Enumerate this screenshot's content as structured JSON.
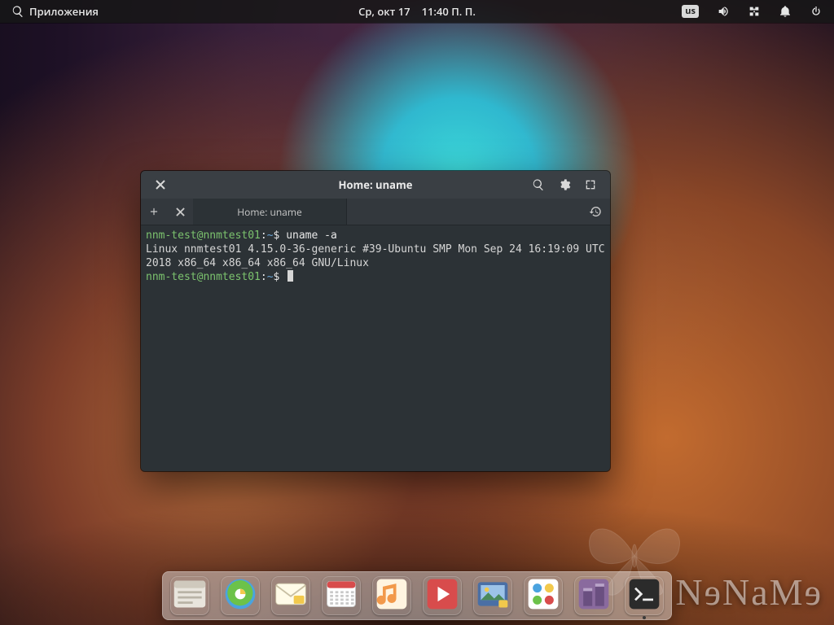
{
  "panel": {
    "apps_label": "Приложения",
    "date": "Ср, окт 17",
    "time": "11:40 П. П.",
    "keyboard_layout": "us"
  },
  "terminal": {
    "window_title": "Home: uname",
    "tab_title": "Home: uname",
    "lines": [
      {
        "user": "nnm-test@nnmtest01",
        "path": "~",
        "symbol": "$",
        "cmd": "uname -a"
      },
      {
        "text": "Linux nnmtest01 4.15.0-36-generic #39-Ubuntu SMP Mon Sep 24 16:19:09 UTC 2018 x86_64 x86_64 x86_64 GNU/Linux"
      },
      {
        "user": "nnm-test@nnmtest01",
        "path": "~",
        "symbol": "$",
        "cmd": ""
      }
    ]
  },
  "dock": {
    "items": [
      {
        "name": "files",
        "label": "Files"
      },
      {
        "name": "web-browser",
        "label": "Web Browser"
      },
      {
        "name": "mail",
        "label": "Mail"
      },
      {
        "name": "calendar",
        "label": "Calendar"
      },
      {
        "name": "music",
        "label": "Music"
      },
      {
        "name": "videos",
        "label": "Videos"
      },
      {
        "name": "photos",
        "label": "Photos"
      },
      {
        "name": "switchboard",
        "label": "System Settings"
      },
      {
        "name": "appcenter",
        "label": "AppCenter"
      },
      {
        "name": "terminal",
        "label": "Terminal",
        "active": true
      }
    ]
  },
  "watermark": "NɘNaMɘ",
  "colors": {
    "panel_bg": "#161616d9",
    "terminal_bg": "#2c3236",
    "terminal_header": "#3a3f44",
    "prompt_user": "#7cc36e",
    "prompt_path": "#6aa6d8"
  }
}
